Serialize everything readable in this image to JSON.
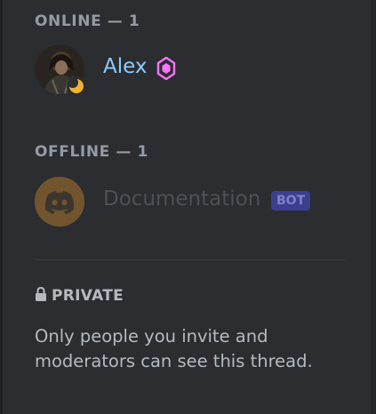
{
  "members": {
    "online_header": "ONLINE — 1",
    "offline_header": "OFFLINE — 1",
    "online": [
      {
        "name": "Alex",
        "avatar_icon": "user-photo-avatar",
        "status_icon": "idle-moon-icon",
        "badge_icon": "server-boost-icon",
        "name_color": "#8ecbff"
      }
    ],
    "offline": [
      {
        "name": "Documentation",
        "avatar_icon": "discord-logo-avatar",
        "tag": "BOT",
        "name_color": "#4e5058"
      }
    ]
  },
  "thread_privacy": {
    "icon": "lock-icon",
    "title": "PRIVATE",
    "description": "Only people you invite and moderators can see this thread."
  },
  "colors": {
    "background": "#2b2d31",
    "idle_status": "#f0b232",
    "boost_pink": "#ff73fa",
    "bot_badge_bg": "#3c3f8f"
  }
}
